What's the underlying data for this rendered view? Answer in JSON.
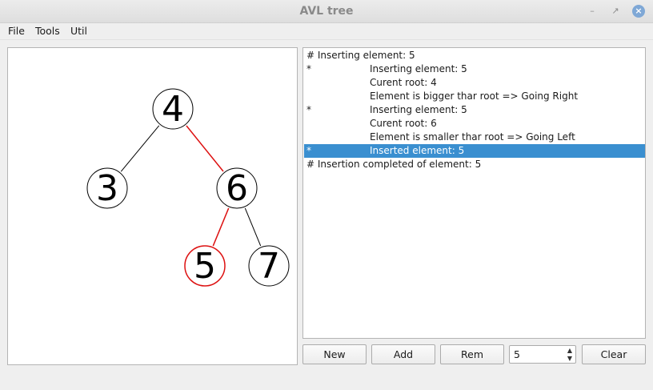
{
  "window": {
    "title": "AVL tree",
    "controls": {
      "minimize": "–",
      "maximize": "↗",
      "close": "×"
    }
  },
  "menu": [
    "File",
    "Tools",
    "Util"
  ],
  "tree": {
    "nodes": [
      {
        "id": "n4",
        "label": "4",
        "highlight": false
      },
      {
        "id": "n3",
        "label": "3",
        "highlight": false
      },
      {
        "id": "n6",
        "label": "6",
        "highlight": false
      },
      {
        "id": "n5",
        "label": "5",
        "highlight": true
      },
      {
        "id": "n7",
        "label": "7",
        "highlight": false
      }
    ],
    "edges": [
      {
        "from": "n4",
        "to": "n3",
        "highlight": false
      },
      {
        "from": "n4",
        "to": "n6",
        "highlight": true
      },
      {
        "from": "n6",
        "to": "n5",
        "highlight": true
      },
      {
        "from": "n6",
        "to": "n7",
        "highlight": false
      }
    ]
  },
  "log": [
    {
      "marker": "",
      "text": "# Inserting element: 5",
      "indent": false,
      "selected": false
    },
    {
      "marker": "*",
      "text": "Inserting element: 5",
      "indent": true,
      "selected": false
    },
    {
      "marker": "",
      "text": "Curent root: 4",
      "indent": true,
      "selected": false
    },
    {
      "marker": "",
      "text": "Element is bigger thar root => Going Right",
      "indent": true,
      "selected": false
    },
    {
      "marker": "*",
      "text": "Inserting element: 5",
      "indent": true,
      "selected": false
    },
    {
      "marker": "",
      "text": "Curent root: 6",
      "indent": true,
      "selected": false
    },
    {
      "marker": "",
      "text": "Element is smaller thar root => Going Left",
      "indent": true,
      "selected": false
    },
    {
      "marker": "*",
      "text": "Inserted element: 5",
      "indent": true,
      "selected": true
    },
    {
      "marker": "",
      "text": "# Insertion completed of element: 5",
      "indent": false,
      "selected": false
    }
  ],
  "controls": {
    "new_label": "New",
    "add_label": "Add",
    "rem_label": "Rem",
    "value": "5",
    "clear_label": "Clear"
  },
  "colors": {
    "highlight": "#dd1111",
    "selection": "#3a8fd0",
    "edge": "#000000"
  }
}
